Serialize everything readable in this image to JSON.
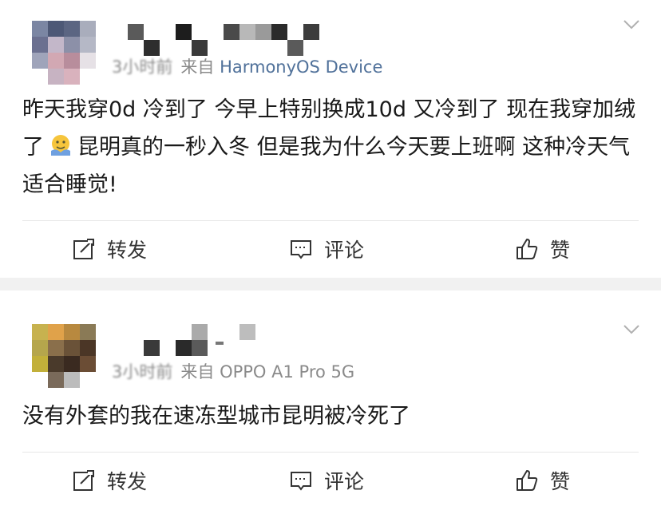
{
  "posts": [
    {
      "time": "3小时前",
      "source_prefix": "来自",
      "device": "HarmonyOS Device",
      "content_parts": [
        "昨天我穿0d 冷到了 今早上特别换成10d 又冷到了 现在我穿加绒了",
        "昆明真的一秒入冬 但是我为什么今天要上班啊 这种冷天气适合睡觉!"
      ],
      "actions": {
        "repost": "转发",
        "comment": "评论",
        "like": "赞"
      }
    },
    {
      "time": "3小时前",
      "source_prefix": "来自",
      "device": "OPPO A1 Pro 5G",
      "content": "没有外套的我在速冻型城市昆明被冷死了",
      "actions": {
        "repost": "转发",
        "comment": "评论",
        "like": "赞"
      }
    }
  ],
  "colors": {
    "device_link": "#50719a",
    "meta_gray": "#8a8a8a",
    "separator": "#f1f1f1"
  },
  "icons": [
    "chevron-down-icon",
    "repost-icon",
    "comment-icon",
    "like-icon",
    "emoji-icon"
  ]
}
